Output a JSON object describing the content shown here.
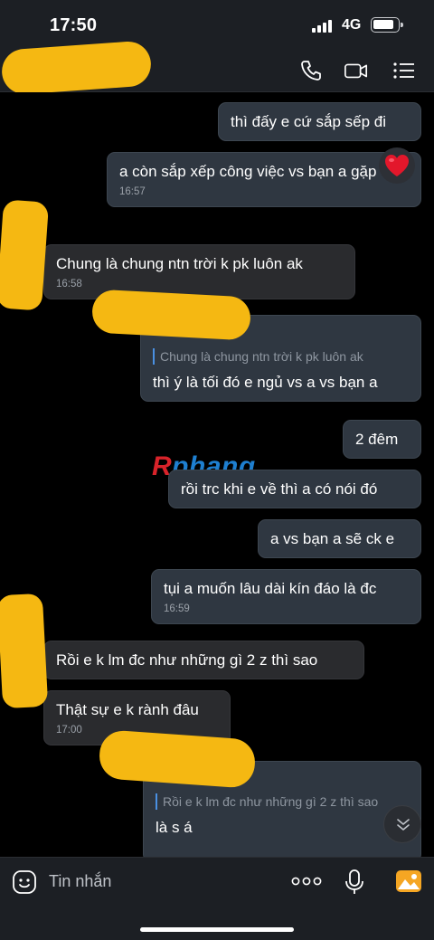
{
  "status_bar": {
    "time": "17:50",
    "network": "4G"
  },
  "messages": [
    {
      "id": "m1",
      "direction": "out",
      "text": "thì đấy e cứ sắp sếp đi"
    },
    {
      "id": "m2",
      "direction": "out",
      "text": "a còn sắp xếp công việc vs bạn a gặp e",
      "time": "16:57",
      "reaction": "heart"
    },
    {
      "id": "m3",
      "direction": "in",
      "text": "Chung là chung ntn trời k pk luôn ak",
      "time": "16:58"
    },
    {
      "id": "m4",
      "direction": "out",
      "quote": "Chung là chung ntn trời k pk luôn ak",
      "text": "thì ý là tối đó e ngủ vs a vs bạn a"
    },
    {
      "id": "m5",
      "direction": "out",
      "text": "2 đêm"
    },
    {
      "id": "m6",
      "direction": "out",
      "text": "rồi trc khi e về thì a có nói đó"
    },
    {
      "id": "m7",
      "direction": "out",
      "text": "a vs bạn a sẽ ck e"
    },
    {
      "id": "m8",
      "direction": "out",
      "text": "tụi a muốn lâu dài kín đáo là đc",
      "time": "16:59"
    },
    {
      "id": "m9",
      "direction": "in",
      "text": "Rồi e k lm đc như những gì 2 z thì sao"
    },
    {
      "id": "m10",
      "direction": "in",
      "text": "Thật sự e k rành đâu",
      "time": "17:00"
    },
    {
      "id": "m11",
      "direction": "out",
      "quote": "Rồi e k lm đc như những gì 2 z thì sao",
      "text": "là s á"
    }
  ],
  "watermark": {
    "first": "R",
    "rest": "phang"
  },
  "composer": {
    "placeholder": "Tin nhắn"
  },
  "icons": [
    "phone-icon",
    "video-call-icon",
    "menu-list-icon",
    "sticker-icon",
    "more-dots-icon",
    "microphone-icon",
    "image-icon",
    "scroll-down-icon",
    "heart-reaction-icon"
  ],
  "colors": {
    "accent_blue": "#4a90e2",
    "outgoing_bubble": "#2f3741",
    "incoming_bubble": "#2a2b2e",
    "censor_yellow": "#f5b812"
  }
}
